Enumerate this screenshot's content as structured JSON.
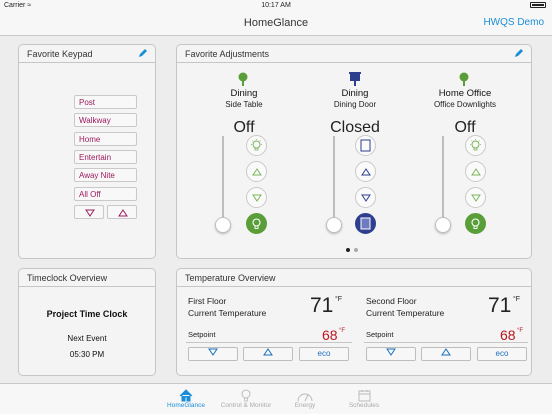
{
  "status": {
    "carrier": "Carrier",
    "time": "10:17 AM"
  },
  "nav": {
    "title": "HomeGlance",
    "right": "HWQS Demo"
  },
  "keypad": {
    "title": "Favorite Keypad",
    "buttons": [
      "Post",
      "Walkway",
      "Home",
      "Entertain",
      "Away Nite",
      "All Off"
    ]
  },
  "adjust": {
    "title": "Favorite Adjustments",
    "columns": [
      {
        "name": "Dining",
        "sub": "Side Table",
        "state": "Off",
        "type": "light"
      },
      {
        "name": "Dining",
        "sub": "Dining Door",
        "state": "Closed",
        "type": "shade"
      },
      {
        "name": "Home Office",
        "sub": "Office Downlights",
        "state": "Off",
        "type": "light"
      }
    ]
  },
  "timeclock": {
    "title": "Timeclock Overview",
    "name": "Project Time Clock",
    "event_label": "Next Event",
    "event_time": "05:30 PM"
  },
  "temperature": {
    "title": "Temperature Overview",
    "zones": [
      {
        "line1": "First Floor",
        "line2": "Current Temperature",
        "temp": "71",
        "unit": "°F",
        "setpoint_label": "Setpoint",
        "setpoint": "68",
        "setpoint_unit": "°F",
        "eco": "eco"
      },
      {
        "line1": "Second Floor",
        "line2": "Current Temperature",
        "temp": "71",
        "unit": "°F",
        "setpoint_label": "Setpoint",
        "setpoint": "68",
        "setpoint_unit": "°F",
        "eco": "eco"
      }
    ]
  },
  "tabs": [
    {
      "label": "HomeGlance",
      "icon": "home-icon",
      "active": true
    },
    {
      "label": "Control & Monitor",
      "icon": "lightbulb-icon",
      "active": false
    },
    {
      "label": "Energy",
      "icon": "energy-icon",
      "active": false
    },
    {
      "label": "Schedules",
      "icon": "calendar-icon",
      "active": false
    }
  ],
  "colors": {
    "accent": "#1a8ed8",
    "keypad_text": "#9b1a5e",
    "green": "#5a9e3a",
    "shade_blue": "#2f3f8f",
    "setpoint_red": "#b81820"
  }
}
